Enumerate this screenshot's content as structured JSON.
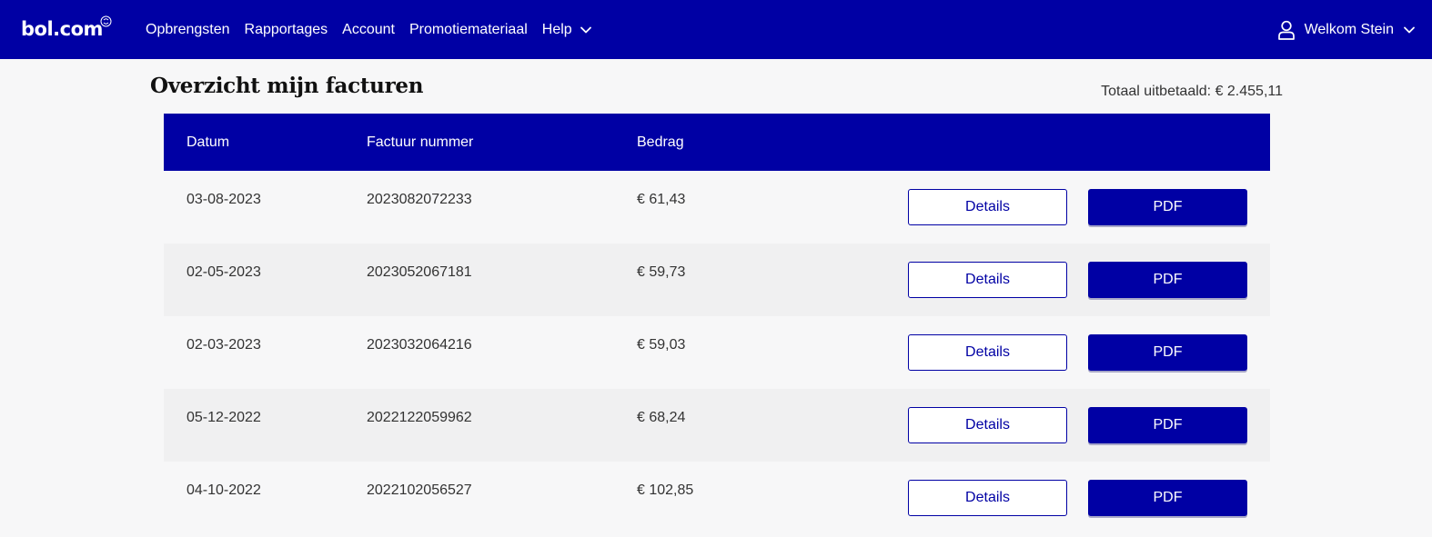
{
  "colors": {
    "brand": "#0000a4",
    "background": "#f7f7f8",
    "row_alt": "#f0f0f1"
  },
  "header": {
    "logo": "bol.com",
    "nav": [
      {
        "label": "Opbrengsten"
      },
      {
        "label": "Rapportages"
      },
      {
        "label": "Account"
      },
      {
        "label": "Promotiemateriaal"
      },
      {
        "label": "Help",
        "icon": "chevron-down-icon"
      }
    ],
    "user": {
      "label": "Welkom Stein",
      "icon": "user-icon"
    }
  },
  "main": {
    "title": "Overzicht mijn facturen",
    "total": "Totaal uitbetaald: € 2.455,11",
    "table": {
      "headers": {
        "date": "Datum",
        "number": "Factuur nummer",
        "amount": "Bedrag"
      },
      "rows": [
        {
          "date": "03-08-2023",
          "number": "2023082072233",
          "amount": "€ 61,43",
          "details": "Details",
          "pdf": "PDF"
        },
        {
          "date": "02-05-2023",
          "number": "2023052067181",
          "amount": "€ 59,73",
          "details": "Details",
          "pdf": "PDF"
        },
        {
          "date": "02-03-2023",
          "number": "2023032064216",
          "amount": "€ 59,03",
          "details": "Details",
          "pdf": "PDF"
        },
        {
          "date": "05-12-2022",
          "number": "2022122059962",
          "amount": "€ 68,24",
          "details": "Details",
          "pdf": "PDF"
        },
        {
          "date": "04-10-2022",
          "number": "2022102056527",
          "amount": "€ 102,85",
          "details": "Details",
          "pdf": "PDF"
        }
      ]
    }
  }
}
